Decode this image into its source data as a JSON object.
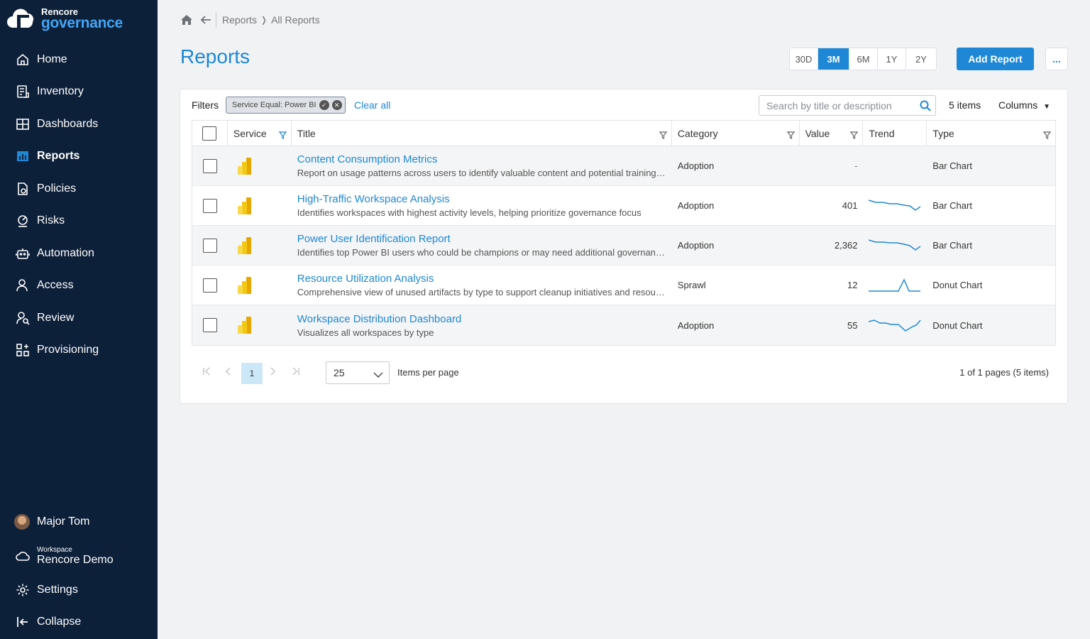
{
  "brand": {
    "top": "Rencore",
    "bottom": "governance"
  },
  "nav": [
    {
      "label": "Home",
      "icon": "home-icon"
    },
    {
      "label": "Inventory",
      "icon": "inventory-icon"
    },
    {
      "label": "Dashboards",
      "icon": "dashboards-icon"
    },
    {
      "label": "Reports",
      "icon": "reports-icon",
      "active": true
    },
    {
      "label": "Policies",
      "icon": "policies-icon"
    },
    {
      "label": "Risks",
      "icon": "risks-icon"
    },
    {
      "label": "Automation",
      "icon": "automation-icon"
    },
    {
      "label": "Access",
      "icon": "access-icon"
    },
    {
      "label": "Review",
      "icon": "review-icon"
    },
    {
      "label": "Provisioning",
      "icon": "provisioning-icon"
    }
  ],
  "user": {
    "name": "Major Tom"
  },
  "workspace": {
    "caption": "Workspace",
    "name": "Rencore Demo"
  },
  "settings_label": "Settings",
  "collapse_label": "Collapse",
  "breadcrumb": {
    "items": [
      "Reports",
      "All Reports"
    ]
  },
  "page_title": "Reports",
  "ranges": [
    {
      "label": "30D"
    },
    {
      "label": "3M",
      "selected": true
    },
    {
      "label": "6M"
    },
    {
      "label": "1Y"
    },
    {
      "label": "2Y"
    }
  ],
  "add_report_label": "Add Report",
  "more_label": "...",
  "filters": {
    "label": "Filters",
    "chip": "Service Equal: Power BI",
    "clear_all": "Clear all"
  },
  "search": {
    "placeholder": "Search by title or description"
  },
  "items_count": "5 items",
  "columns_label": "Columns",
  "table": {
    "headers": {
      "service": "Service",
      "title": "Title",
      "category": "Category",
      "value": "Value",
      "trend": "Trend",
      "type": "Type"
    },
    "rows": [
      {
        "title": "Content Consumption Metrics",
        "desc": "Report on usage patterns across users to identify valuable content and potential training needs",
        "category": "Adoption",
        "value": "-",
        "trend": "none",
        "type": "Bar Chart"
      },
      {
        "title": "High-Traffic Workspace Analysis",
        "desc": "Identifies workspaces with highest activity levels, helping prioritize governance focus",
        "category": "Adoption",
        "value": "401",
        "trend": "decline",
        "type": "Bar Chart"
      },
      {
        "title": "Power User Identification Report",
        "desc": "Identifies top Power BI users who could be champions or may need additional governance oversight",
        "category": "Adoption",
        "value": "2,362",
        "trend": "decline",
        "type": "Bar Chart"
      },
      {
        "title": "Resource Utilization Analysis",
        "desc": "Comprehensive view of unused artifacts by type to support cleanup initiatives and resource optimization",
        "category": "Sprawl",
        "value": "12",
        "trend": "spike",
        "type": "Donut Chart"
      },
      {
        "title": "Workspace Distribution Dashboard",
        "desc": "Visualizes all workspaces by type",
        "category": "Adoption",
        "value": "55",
        "trend": "wave",
        "type": "Donut Chart"
      }
    ]
  },
  "pager": {
    "current": "1",
    "per_page": "25",
    "per_page_label": "Items per page",
    "info": "1 of 1 pages (5 items)"
  },
  "colors": {
    "sidebar": "#0d2039",
    "accent": "#1e88d6",
    "powerbi": "#f2c811"
  }
}
